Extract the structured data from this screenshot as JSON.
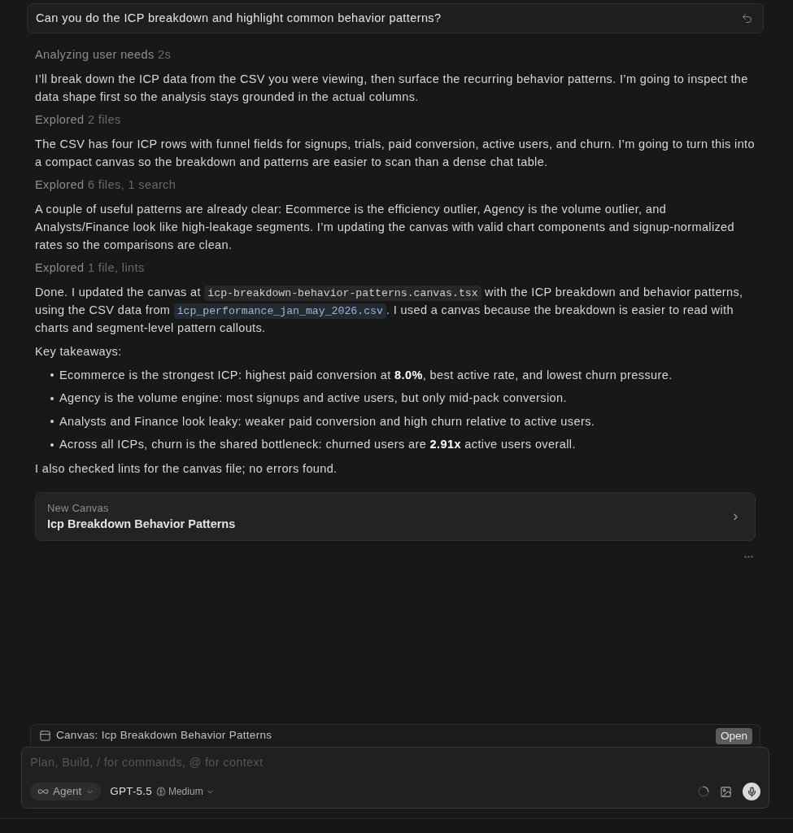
{
  "user_message": {
    "text": "Can you do the ICP breakdown and highlight common behavior patterns?"
  },
  "transcript": [
    {
      "kind": "status",
      "label": "Analyzing user needs",
      "detail": "2s"
    },
    {
      "kind": "paragraph",
      "segments": [
        {
          "kind": "text",
          "text": "I’ll break down the ICP data from the CSV you were viewing, then surface the recurring behavior patterns. I’m going to inspect the data shape first so the analysis stays grounded in the actual columns."
        }
      ]
    },
    {
      "kind": "status",
      "label": "Explored",
      "detail": "2 files"
    },
    {
      "kind": "paragraph",
      "segments": [
        {
          "kind": "text",
          "text": "The CSV has four ICP rows with funnel fields for signups, trials, paid conversion, active users, and churn. I’m going to turn this into a compact canvas so the breakdown and patterns are easier to scan than a dense chat table."
        }
      ]
    },
    {
      "kind": "status",
      "label": "Explored",
      "detail": "6 files, 1 search"
    },
    {
      "kind": "paragraph",
      "segments": [
        {
          "kind": "text",
          "text": "A couple of useful patterns are already clear: Ecommerce is the efficiency outlier, Agency is the volume outlier, and Analysts/Finance look like high-leakage segments. I’m updating the canvas with valid chart components and signup-normalized rates so the comparisons are clean."
        }
      ]
    },
    {
      "kind": "status",
      "label": "Explored",
      "detail": "1 file, lints"
    },
    {
      "kind": "paragraph",
      "segments": [
        {
          "kind": "text",
          "text": "Done. I updated the canvas at "
        },
        {
          "kind": "code",
          "text": "icp-breakdown-behavior-patterns.canvas.tsx"
        },
        {
          "kind": "text",
          "text": " with the ICP breakdown and behavior patterns, using the CSV data from "
        },
        {
          "kind": "file",
          "text": "icp_performance_jan_may_2026.csv"
        },
        {
          "kind": "text",
          "text": ". I used a canvas because the breakdown is easier to read with charts and segment-level pattern callouts."
        }
      ]
    },
    {
      "kind": "paragraph",
      "segments": [
        {
          "kind": "text",
          "text": "Key takeaways:"
        }
      ]
    },
    {
      "kind": "bullets",
      "items": [
        "Ecommerce is the strongest ICP: highest paid conversion at **8.0%**, best active rate, and lowest churn pressure.",
        "Agency is the volume engine: most signups and active users, but only mid-pack conversion.",
        "Analysts and Finance look leaky: weaker paid conversion and high churn relative to active users.",
        "Across all ICPs, churn is the shared bottleneck: churned users are **2.91x** active users overall."
      ]
    },
    {
      "kind": "paragraph",
      "segments": [
        {
          "kind": "text",
          "text": "I also checked lints for the canvas file; no errors found."
        }
      ]
    }
  ],
  "canvas_card": {
    "label": "New Canvas",
    "title": "Icp Breakdown Behavior Patterns"
  },
  "canvas_bar": {
    "label": "Canvas: Icp Breakdown Behavior Patterns",
    "button": "Open"
  },
  "composer": {
    "placeholder": "Plan, Build, / for commands, @ for context",
    "mode": "Agent",
    "model": "GPT-5.5",
    "effort": "Medium"
  }
}
